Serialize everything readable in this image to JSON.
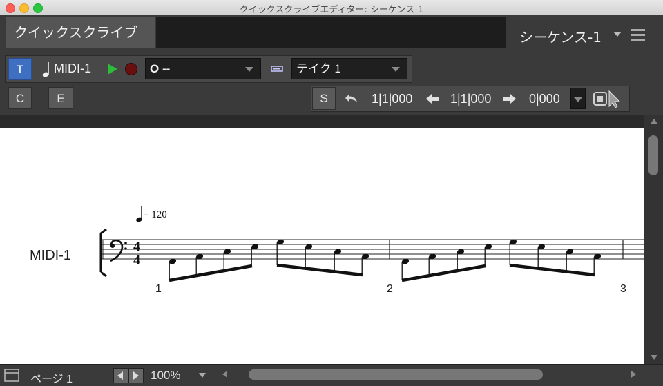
{
  "window": {
    "title": "クイックスクライブエディター: シーケンス-1"
  },
  "header": {
    "tab_label": "クイックスクライブ",
    "sequence_name": "シーケンス-1"
  },
  "toolbar1": {
    "track_button": "T",
    "track_name": "MIDI-1",
    "output_value": "O --",
    "take_value": "テイク 1"
  },
  "toolbar2": {
    "c_button": "C",
    "e_button": "E",
    "s_button": "S",
    "start_position": "1|1|000",
    "end_position": "1|1|000",
    "length_value": "0|000"
  },
  "score": {
    "track_label": "MIDI-1",
    "tempo_value": "= 120",
    "time_signature_top": "4",
    "time_signature_bottom": "4",
    "measure_numbers": [
      "1",
      "2",
      "3"
    ]
  },
  "status": {
    "page_label": "ページ 1",
    "zoom_value": "100%"
  },
  "colors": {
    "accent_blue": "#3f6fc1",
    "play_green": "#2bbd3a",
    "record_red": "#6a0f0f"
  }
}
